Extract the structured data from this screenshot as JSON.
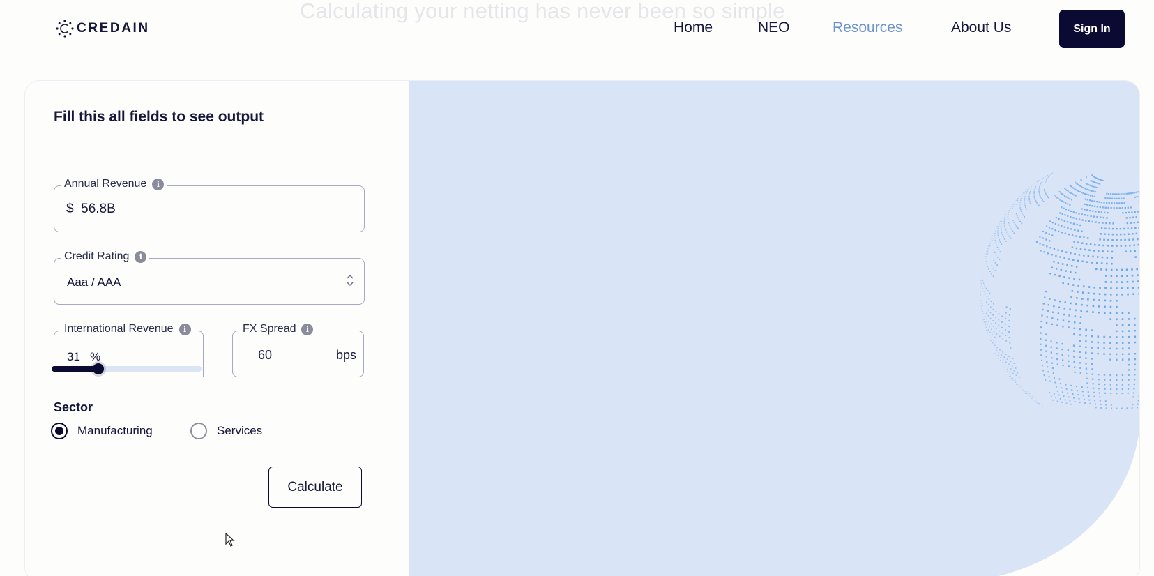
{
  "headline": "Calculating your netting has never been so simple",
  "brand": {
    "name": "CREDAIN"
  },
  "nav": {
    "items": [
      {
        "label": "Home"
      },
      {
        "label": "NEO"
      },
      {
        "label": "Resources"
      },
      {
        "label": "About Us"
      }
    ],
    "active": "Resources",
    "sign_in_label": "Sign In"
  },
  "form": {
    "title": "Fill this all fields to see output",
    "annual_revenue": {
      "label": "Annual Revenue",
      "currency": "$",
      "value": "56.8B"
    },
    "credit_rating": {
      "label": "Credit Rating",
      "selected": "Aaa / AAA"
    },
    "international_revenue": {
      "label": "International Revenue",
      "value": "31",
      "unit": "%",
      "slider_fraction": 0.31
    },
    "fx_spread": {
      "label": "FX Spread",
      "value": "60",
      "unit": "bps"
    },
    "sector": {
      "label": "Sector",
      "options": [
        {
          "label": "Manufacturing",
          "selected": true
        },
        {
          "label": "Services",
          "selected": false
        }
      ]
    },
    "calculate_label": "Calculate"
  },
  "colors": {
    "primary": "#0b0a33",
    "active_nav": "#6d93cf",
    "panel_bg": "#d9e5f7",
    "globe_dots": "#69a5ea"
  },
  "icons": {
    "info": "info-icon",
    "select": "chevron-up-down-icon",
    "globe": "dotted-globe-illustration",
    "cursor": "mouse-pointer-icon"
  }
}
